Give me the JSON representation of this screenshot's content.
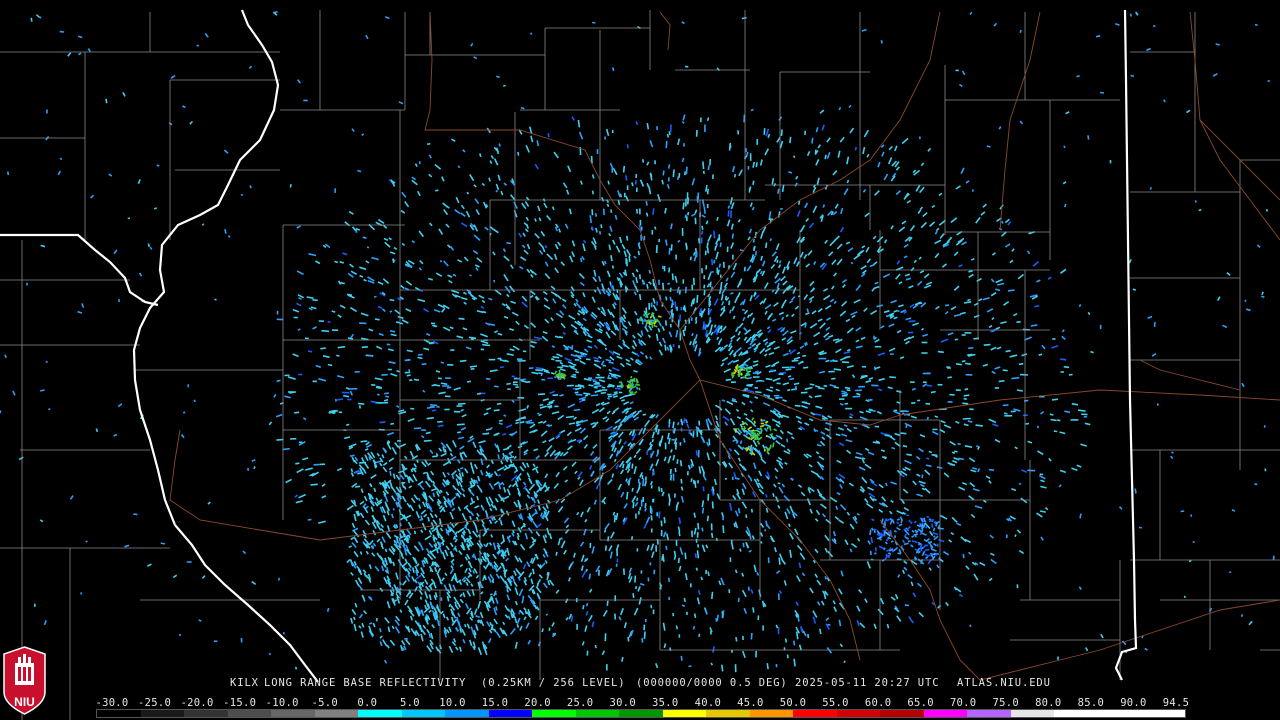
{
  "caption": {
    "radar": "KILX",
    "product": "LONG RANGE BASE REFLECTIVITY",
    "resolution": "(0.25KM / 256 LEVEL)",
    "vcp": "(000000/0000 0.5 DEG)",
    "datetime": "2025-05-11 20:27 UTC",
    "site": "ATLAS.NIU.EDU"
  },
  "scale": {
    "labels": [
      "-30.0",
      "-25.0",
      "-20.0",
      "-15.0",
      "-10.0",
      "-5.0",
      "0.0",
      "5.0",
      "10.0",
      "15.0",
      "20.0",
      "25.0",
      "30.0",
      "35.0",
      "40.0",
      "45.0",
      "50.0",
      "55.0",
      "60.0",
      "65.0",
      "70.0",
      "75.0",
      "80.0",
      "85.0",
      "90.0",
      "94.5"
    ],
    "colors": [
      "#000000",
      "#1a1a1a",
      "#333333",
      "#4d4d4d",
      "#666666",
      "#808080",
      "#00ffff",
      "#00c8ff",
      "#0096ff",
      "#0000ff",
      "#00ff00",
      "#00c800",
      "#009600",
      "#ffff00",
      "#e6c800",
      "#ff9600",
      "#ff0000",
      "#d20000",
      "#b40000",
      "#ff00ff",
      "#b464ff",
      "#e6e6e6",
      "#ffffff",
      "#ffffff",
      "#ffffff"
    ]
  },
  "logo": {
    "text": "NIU",
    "colors": {
      "red": "#c8102e",
      "white": "#ffffff"
    }
  },
  "map": {
    "colors": {
      "county": "#8a8a8a",
      "state": "#ffffff",
      "highway": "#8b4a2b",
      "echo_light": "#3fd0f0",
      "echo_mid": "#2aa0ff",
      "echo_strong": "#1a5cff",
      "echo_green": "#3cc83c",
      "echo_yellow": "#d2d200"
    }
  }
}
